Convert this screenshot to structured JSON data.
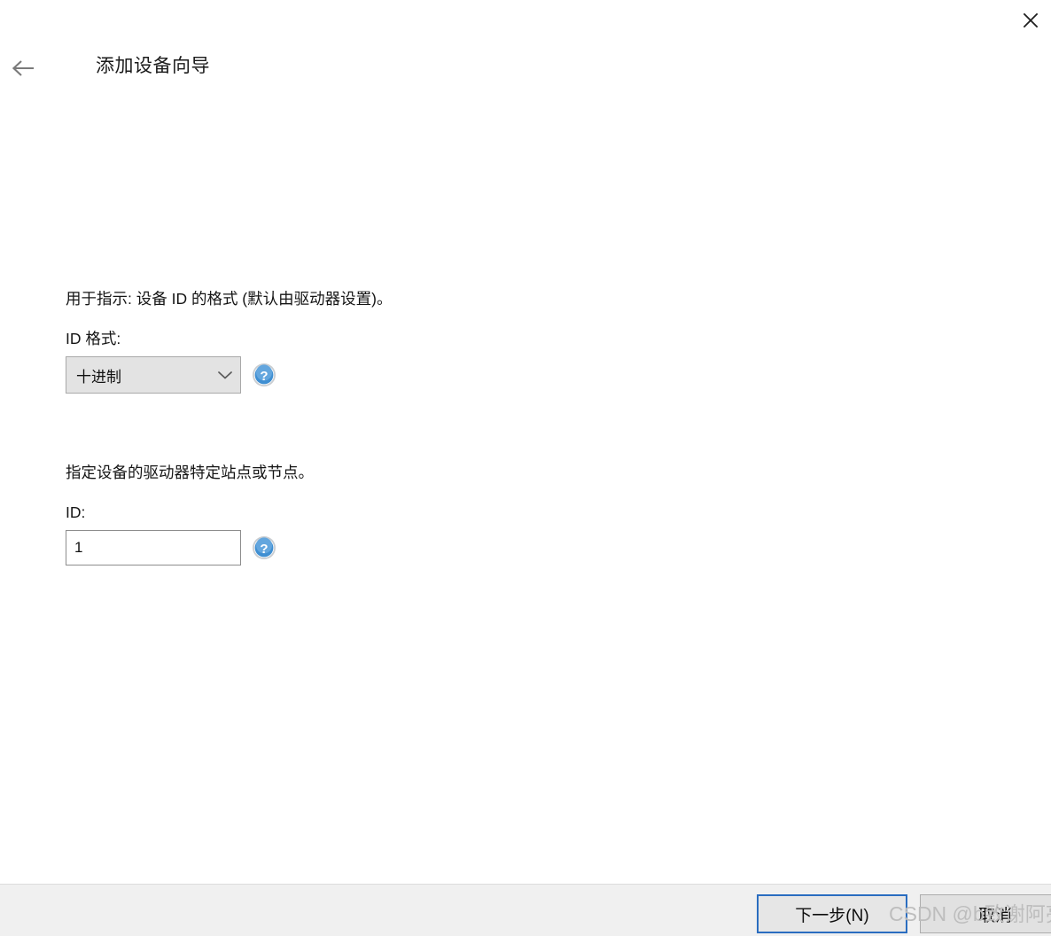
{
  "window": {
    "title": "添加设备向导",
    "close_label": "✕",
    "back_label": "←"
  },
  "icons": {
    "close": "close-icon",
    "back": "back-arrow-icon",
    "chevron_down": "chevron-down-icon",
    "help": "help-icon"
  },
  "main": {
    "sections": [
      {
        "description": "用于指示: 设备 ID 的格式 (默认由驱动器设置)。",
        "label": "ID 格式:",
        "control": "combo",
        "value": "十进制",
        "options": [
          "十进制"
        ],
        "help": "?"
      },
      {
        "description": "指定设备的驱动器特定站点或节点。",
        "label": "ID:",
        "control": "input",
        "value": "1",
        "placeholder": "",
        "help": "?"
      }
    ]
  },
  "footer": {
    "next_label": "下一步(N)",
    "cancel_label": "取消"
  },
  "watermark": {
    "text": "CSDN @b致谢阿亮"
  },
  "colors": {
    "accent": "#2a6dc0",
    "help_blue": "#3f8fd2",
    "footer_bg": "#f0f0f0",
    "combo_bg": "#e3e3e3",
    "watermark": "#bdbdbd"
  }
}
